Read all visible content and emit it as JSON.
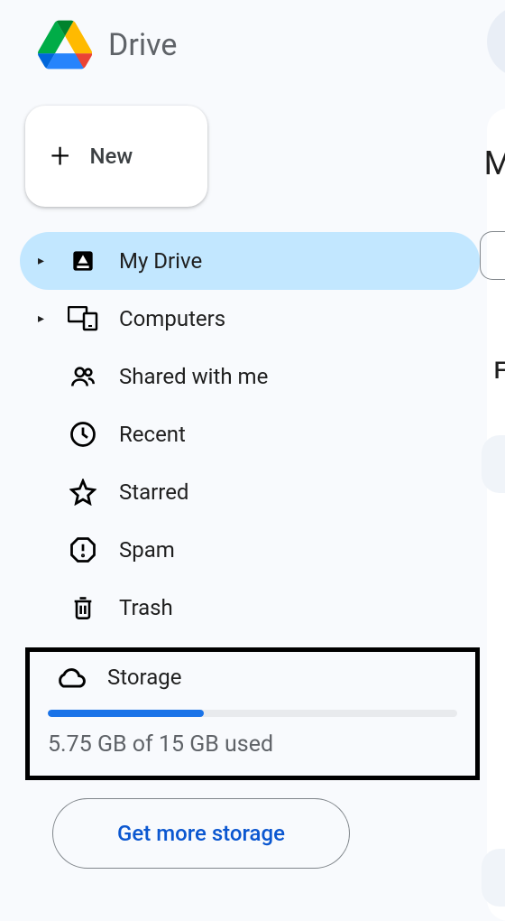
{
  "header": {
    "app_title": "Drive"
  },
  "new_button": {
    "label": "New"
  },
  "nav": {
    "items": [
      {
        "label": "My Drive",
        "has_arrow": true,
        "active": true
      },
      {
        "label": "Computers",
        "has_arrow": true,
        "active": false
      },
      {
        "label": "Shared with me",
        "has_arrow": false,
        "active": false
      },
      {
        "label": "Recent",
        "has_arrow": false,
        "active": false
      },
      {
        "label": "Starred",
        "has_arrow": false,
        "active": false
      },
      {
        "label": "Spam",
        "has_arrow": false,
        "active": false
      },
      {
        "label": "Trash",
        "has_arrow": false,
        "active": false
      }
    ]
  },
  "storage": {
    "label": "Storage",
    "used_text": "5.75 GB of 15 GB used",
    "percent": 38,
    "button_label": "Get more storage"
  },
  "peek": {
    "letter1": "M",
    "letter2": "F"
  }
}
